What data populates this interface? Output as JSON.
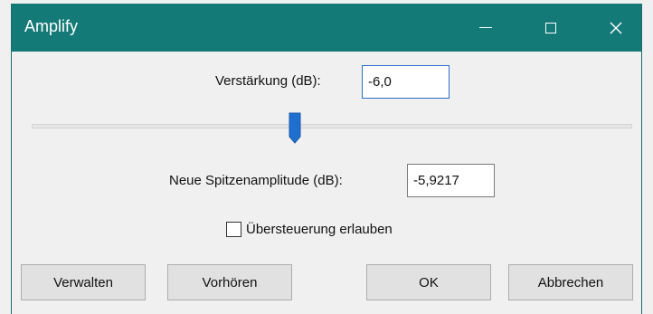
{
  "window": {
    "title": "Amplify",
    "controls": {
      "minimize_icon": "minimize-icon",
      "maximize_icon": "maximize-icon",
      "close_icon": "close-icon",
      "close_glyph": "✕"
    },
    "titlebar_color": "#147a78"
  },
  "gain": {
    "label": "Verstärkung (dB):",
    "value": "-6,0"
  },
  "slider": {
    "value_db": -6.0
  },
  "peak": {
    "label": "Neue Spitzenamplitude (dB):",
    "value": "-5,9217"
  },
  "clipping": {
    "label": "Übersteuerung erlauben",
    "checked": false
  },
  "buttons": {
    "manage": "Verwalten",
    "preview": "Vorhören",
    "ok": "OK",
    "cancel": "Abbrechen"
  },
  "accent_color": "#2a6fc9"
}
